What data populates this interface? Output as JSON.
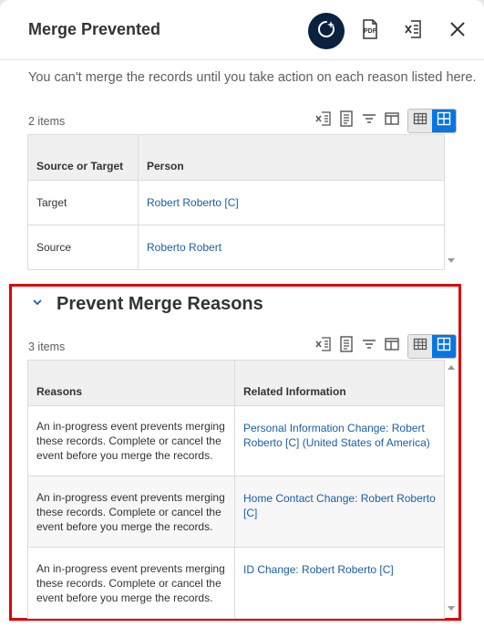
{
  "dialog": {
    "title": "Merge Prevented",
    "intro": "You can't merge the records until you take action on each reason listed here."
  },
  "header_icons": [
    "related-actions-icon",
    "pdf-icon",
    "excel-export-icon",
    "close-icon"
  ],
  "toolbar_icons": [
    "excel-export-icon",
    "print-icon",
    "filter-icon",
    "column-layout-icon",
    "table-view-icon",
    "grid-view-icon"
  ],
  "colors": {
    "accent": "#0875e1",
    "brand_dark": "#0b2140",
    "link": "#1a5ea8",
    "highlight": "#e00000"
  },
  "records": {
    "count": "2 items",
    "columns": [
      "Source or Target",
      "Person"
    ],
    "rows": [
      [
        "Target",
        "Robert Roberto [C]"
      ],
      [
        "Source",
        "Roberto Robert"
      ]
    ]
  },
  "reasons": {
    "title": "Prevent Merge Reasons",
    "count": "3 items",
    "columns": [
      "Reasons",
      "Related Information"
    ],
    "rows": [
      [
        "An in-progress event prevents merging these records. Complete or cancel the event before you merge the records.",
        "Personal Information Change: Robert Roberto [C] (United States of America)"
      ],
      [
        "An in-progress event prevents merging these records. Complete or cancel the event before you merge the records.",
        "Home Contact Change: Robert Roberto [C]"
      ],
      [
        "An in-progress event prevents merging these records. Complete or cancel the event before you merge the records.",
        "ID Change: Robert Roberto [C]"
      ]
    ]
  }
}
